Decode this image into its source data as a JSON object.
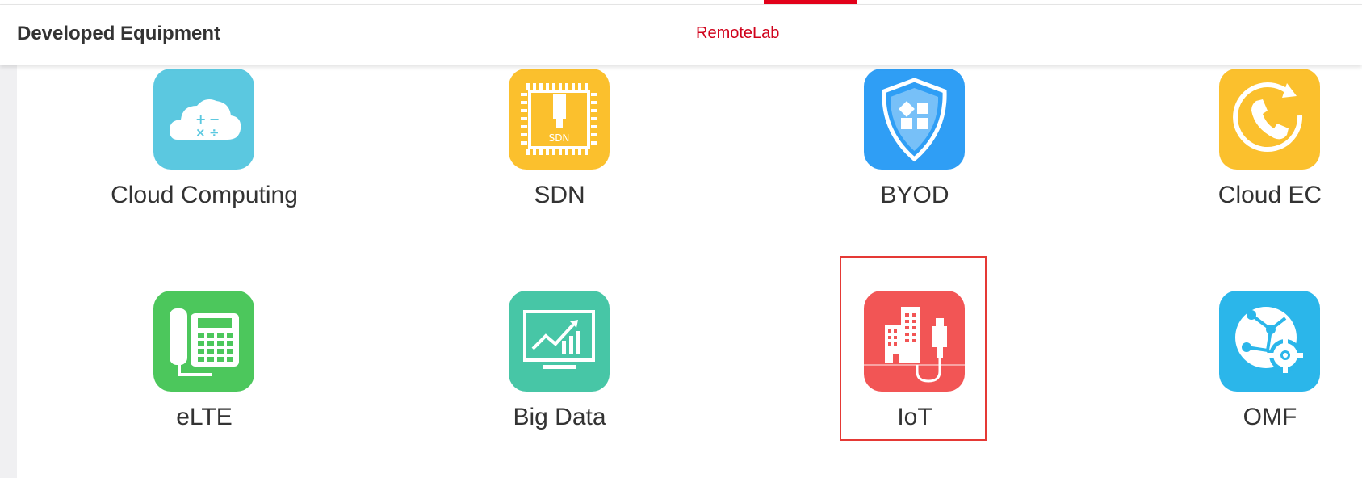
{
  "header": {
    "title": "Developed Equipment",
    "brand": "RemoteLab"
  },
  "tiles": [
    {
      "label": "Cloud Computing",
      "icon": "cloud-calculator-icon",
      "color": "#5bc8e0"
    },
    {
      "label": "SDN",
      "icon": "sdn-chip-icon",
      "color": "#fbc02d"
    },
    {
      "label": "BYOD",
      "icon": "shield-apps-icon",
      "color": "#2f9ef5"
    },
    {
      "label": "Cloud EC",
      "icon": "phone-refresh-icon",
      "color": "#fbc02d"
    },
    {
      "label": "eLTE",
      "icon": "desk-phone-icon",
      "color": "#4cc75c"
    },
    {
      "label": "Big Data",
      "icon": "monitor-chart-icon",
      "color": "#47c6a6"
    },
    {
      "label": "IoT",
      "icon": "building-plug-icon",
      "color": "#f25555",
      "selected": true
    },
    {
      "label": "OMF",
      "icon": "globe-gear-icon",
      "color": "#2bb6ea"
    }
  ],
  "colors": {
    "accent": "#e2001a",
    "selection_border": "#e53935"
  }
}
